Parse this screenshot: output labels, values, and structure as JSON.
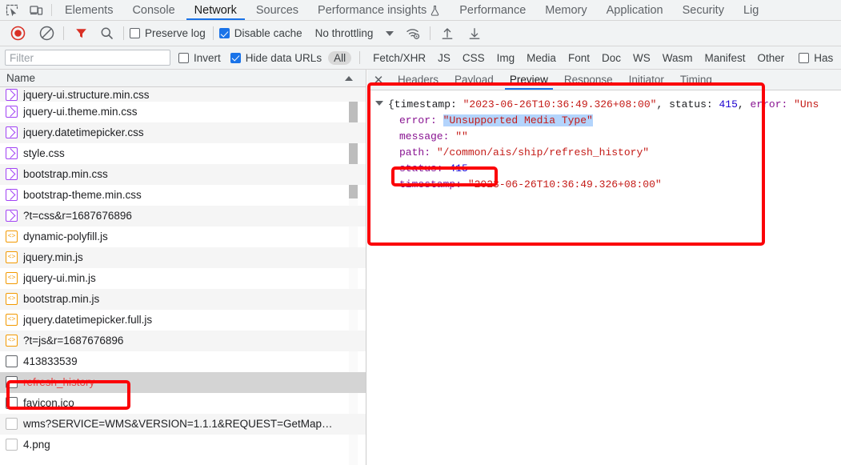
{
  "devtools": {
    "main_tabs": [
      {
        "label": "Elements",
        "active": false
      },
      {
        "label": "Console",
        "active": false
      },
      {
        "label": "Network",
        "active": true
      },
      {
        "label": "Sources",
        "active": false
      },
      {
        "label": "Performance insights",
        "active": false,
        "flask": true
      },
      {
        "label": "Performance",
        "active": false
      },
      {
        "label": "Memory",
        "active": false
      },
      {
        "label": "Application",
        "active": false
      },
      {
        "label": "Security",
        "active": false
      },
      {
        "label": "Lig",
        "active": false,
        "truncated": true
      }
    ],
    "icons": {
      "inspect": "inspect-element-icon",
      "device": "device-toolbar-icon"
    }
  },
  "network_toolbar": {
    "record": {
      "name": "record-button",
      "state": "recording",
      "color": "#d93025"
    },
    "clear": {
      "name": "clear-button"
    },
    "filter": {
      "name": "filter-funnel-icon",
      "active": true,
      "color": "#d93025"
    },
    "search": {
      "name": "search-icon"
    },
    "preserve_log": {
      "label": "Preserve log",
      "checked": false
    },
    "disable_cache": {
      "label": "Disable cache",
      "checked": true
    },
    "throttling": {
      "label": "No throttling",
      "value": "No throttling"
    },
    "network_conditions": "network-conditions-icon",
    "import_har": "import-har-icon",
    "export_har": "export-har-icon"
  },
  "filter_bar": {
    "input_value": "",
    "placeholder": "Filter",
    "invert": {
      "label": "Invert",
      "checked": false
    },
    "hide_data_urls": {
      "label": "Hide data URLs",
      "checked": true
    },
    "types": [
      {
        "label": "All",
        "selected": true
      },
      {
        "label": "Fetch/XHR",
        "selected": false
      },
      {
        "label": "JS",
        "selected": false
      },
      {
        "label": "CSS",
        "selected": false
      },
      {
        "label": "Img",
        "selected": false
      },
      {
        "label": "Media",
        "selected": false
      },
      {
        "label": "Font",
        "selected": false
      },
      {
        "label": "Doc",
        "selected": false
      },
      {
        "label": "WS",
        "selected": false
      },
      {
        "label": "Wasm",
        "selected": false
      },
      {
        "label": "Manifest",
        "selected": false
      },
      {
        "label": "Other",
        "selected": false
      }
    ],
    "has_blocked": {
      "label": "Has",
      "checked": false
    }
  },
  "request_list": {
    "column_header": "Name",
    "rows": [
      {
        "name": "jquery-ui.structure.min.css",
        "type": "css",
        "clipped": true
      },
      {
        "name": "jquery-ui.theme.min.css",
        "type": "css"
      },
      {
        "name": "jquery.datetimepicker.css",
        "type": "css"
      },
      {
        "name": "style.css",
        "type": "css"
      },
      {
        "name": "bootstrap.min.css",
        "type": "css"
      },
      {
        "name": "bootstrap-theme.min.css",
        "type": "css"
      },
      {
        "name": "?t=css&r=1687676896",
        "type": "css"
      },
      {
        "name": "dynamic-polyfill.js",
        "type": "js"
      },
      {
        "name": "jquery.min.js",
        "type": "js"
      },
      {
        "name": "jquery-ui.min.js",
        "type": "js"
      },
      {
        "name": "bootstrap.min.js",
        "type": "js"
      },
      {
        "name": "jquery.datetimepicker.full.js",
        "type": "js"
      },
      {
        "name": "?t=js&r=1687676896",
        "type": "js"
      },
      {
        "name": "413833539",
        "type": "doc"
      },
      {
        "name": "refresh_history",
        "type": "doc",
        "selected": true,
        "error": true
      },
      {
        "name": "favicon.ico",
        "type": "doc"
      },
      {
        "name": "wms?SERVICE=WMS&VERSION=1.1.1&REQUEST=GetMap…",
        "type": "img"
      },
      {
        "name": "4.png",
        "type": "img"
      }
    ]
  },
  "detail_pane": {
    "close_label": "✕",
    "tabs": [
      {
        "label": "Headers",
        "active": false
      },
      {
        "label": "Payload",
        "active": false
      },
      {
        "label": "Preview",
        "active": true
      },
      {
        "label": "Response",
        "active": false
      },
      {
        "label": "Initiator",
        "active": false
      },
      {
        "label": "Timing",
        "active": false
      }
    ],
    "preview": {
      "summary_prefix": "{timestamp: ",
      "summary_timestamp": "\"2023-06-26T10:36:49.326+08:00\"",
      "summary_mid": ", status: ",
      "summary_status": "415",
      "summary_comma": ", ",
      "summary_error_key": "error: ",
      "summary_error_val": "\"Uns",
      "rows": [
        {
          "key": "error: ",
          "value": "\"Unsupported Media Type\"",
          "kind": "string",
          "highlight": true
        },
        {
          "key": "message: ",
          "value": "\"\"",
          "kind": "string"
        },
        {
          "key": "path: ",
          "value": "\"/common/ais/ship/refresh_history\"",
          "kind": "string"
        },
        {
          "key": "status: ",
          "value": "415",
          "kind": "number"
        },
        {
          "key": "timestamp: ",
          "value": "\"2023-06-26T10:36:49.326+08:00\"",
          "kind": "string"
        }
      ]
    }
  },
  "annotations": {
    "color": "#fb0007",
    "boxes": [
      "refresh_history-row-highlight",
      "preview-panel-highlight",
      "status-415-highlight"
    ]
  }
}
